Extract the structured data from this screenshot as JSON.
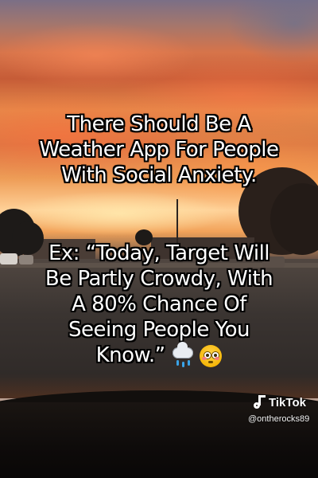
{
  "caption": {
    "part1": [
      "There Should Be A",
      "Weather App For People",
      "With Social Anxiety."
    ],
    "part2": [
      "Ex: “Today, Target Will",
      "Be Partly Crowdy, With",
      "A 80% Chance Of",
      "Seeing People You",
      "Know.”"
    ]
  },
  "emojis": [
    "cloud-with-rain-icon",
    "flushed-face-icon"
  ],
  "watermark": {
    "brand": "TikTok",
    "handle": "@ontherocks89"
  }
}
